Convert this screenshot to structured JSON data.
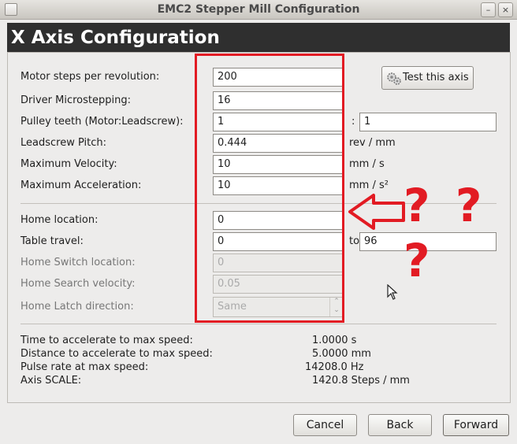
{
  "window": {
    "title": "EMC2 Stepper Mill Configuration"
  },
  "page": {
    "title": "X Axis Configuration"
  },
  "fields": {
    "motor_steps": {
      "label": "Motor steps per revolution:",
      "value": "200"
    },
    "microstepping": {
      "label": "Driver Microstepping:",
      "value": "16"
    },
    "pulley": {
      "label": "Pulley teeth (Motor:Leadscrew):",
      "value": "1",
      "separator": ":",
      "value2": "1"
    },
    "pitch": {
      "label": "Leadscrew Pitch:",
      "value": "0.444",
      "unit": "rev / mm"
    },
    "max_velocity": {
      "label": "Maximum Velocity:",
      "value": "10",
      "unit": "mm / s"
    },
    "max_accel": {
      "label": "Maximum Acceleration:",
      "value": "10",
      "unit": "mm / s²"
    },
    "home_location": {
      "label": "Home location:",
      "value": "0"
    },
    "table_travel": {
      "label": "Table travel:",
      "value": "0",
      "to_label": "to",
      "value2": "96"
    },
    "home_switch": {
      "label": "Home Switch location:",
      "value": "0"
    },
    "home_search_velocity": {
      "label": "Home Search velocity:",
      "value": "0.05"
    },
    "home_latch": {
      "label": "Home Latch direction:",
      "value": "Same"
    }
  },
  "test_button": {
    "label": "Test this axis",
    "icon": "gears-icon"
  },
  "annotation": {
    "marks": "? ? ?",
    "color": "#e21b23"
  },
  "stats": [
    {
      "label": "Time to accelerate to max speed:",
      "value": "1.0000 s"
    },
    {
      "label": "Distance to accelerate to max speed:",
      "value": "5.0000 mm"
    },
    {
      "label": "Pulse rate at max speed:",
      "value": "14208.0 Hz"
    },
    {
      "label": "Axis SCALE:",
      "value": "1420.8 Steps / mm"
    }
  ],
  "buttons": {
    "cancel": "Cancel",
    "back": "Back",
    "forward": "Forward"
  },
  "titlebar_buttons": {
    "minimize": "–",
    "close": "×"
  }
}
